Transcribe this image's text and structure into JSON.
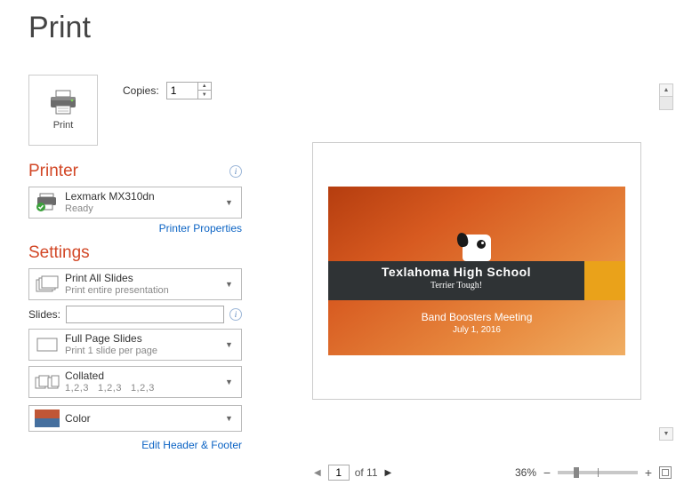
{
  "page_title": "Print",
  "print_button": {
    "label": "Print"
  },
  "copies": {
    "label": "Copies:",
    "value": "1"
  },
  "printer": {
    "heading": "Printer",
    "name": "Lexmark MX310dn",
    "status": "Ready",
    "properties_link": "Printer Properties"
  },
  "settings": {
    "heading": "Settings",
    "slides_label": "Slides:",
    "slides_value": "",
    "what_to_print": {
      "primary": "Print All Slides",
      "secondary": "Print entire presentation"
    },
    "layout": {
      "primary": "Full Page Slides",
      "secondary": "Print 1 slide per page"
    },
    "collate": {
      "primary": "Collated",
      "secondary_group": "1,2,3"
    },
    "color": {
      "primary": "Color"
    },
    "edit_header_link": "Edit Header & Footer"
  },
  "preview": {
    "slide_title": "Texlahoma High School",
    "slide_subtitle": "Terrier Tough!",
    "meeting_line": "Band Boosters Meeting",
    "date_line": "July 1, 2016"
  },
  "nav": {
    "current_page": "1",
    "of_label": "of 11",
    "zoom_label": "36%"
  }
}
